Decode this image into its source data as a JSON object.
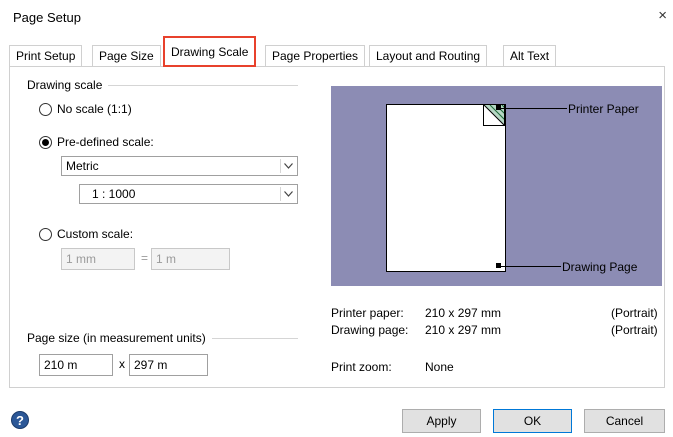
{
  "window": {
    "title": "Page Setup",
    "close_glyph": "×"
  },
  "tabs": [
    {
      "label": "Print Setup"
    },
    {
      "label": "Page Size"
    },
    {
      "label": "Drawing Scale",
      "active": true
    },
    {
      "label": "Page Properties"
    },
    {
      "label": "Layout and Routing"
    },
    {
      "label": "Alt Text"
    }
  ],
  "drawing_scale": {
    "group_label": "Drawing scale",
    "no_scale_label": "No scale (1:1)",
    "predefined_label": "Pre-defined scale:",
    "predefined_checked": true,
    "predefined_category": "Metric",
    "predefined_ratio": "1 : 1000",
    "custom_label": "Custom scale:",
    "custom_left": "1 mm",
    "custom_sep": "=",
    "custom_right": "1 m"
  },
  "page_size": {
    "group_label": "Page size (in measurement units)",
    "width": "210 m",
    "sep": "x",
    "height": "297 m"
  },
  "preview": {
    "printer_paper_label": "Printer Paper",
    "drawing_page_label": "Drawing Page",
    "background_color": "#8c8cb4",
    "hatch_color": "#2e8b57"
  },
  "info": {
    "printer_paper_key": "Printer paper:",
    "printer_paper_value": "210 x 297 mm",
    "printer_paper_orientation": "(Portrait)",
    "drawing_page_key": "Drawing page:",
    "drawing_page_value": "210 x 297 mm",
    "drawing_page_orientation": "(Portrait)",
    "print_zoom_key": "Print zoom:",
    "print_zoom_value": "None"
  },
  "buttons": {
    "help": "?",
    "apply": "Apply",
    "ok": "OK",
    "cancel": "Cancel"
  },
  "icons": {
    "help": "help-icon",
    "close": "close-icon",
    "dropdown": "chevron-down-icon"
  }
}
